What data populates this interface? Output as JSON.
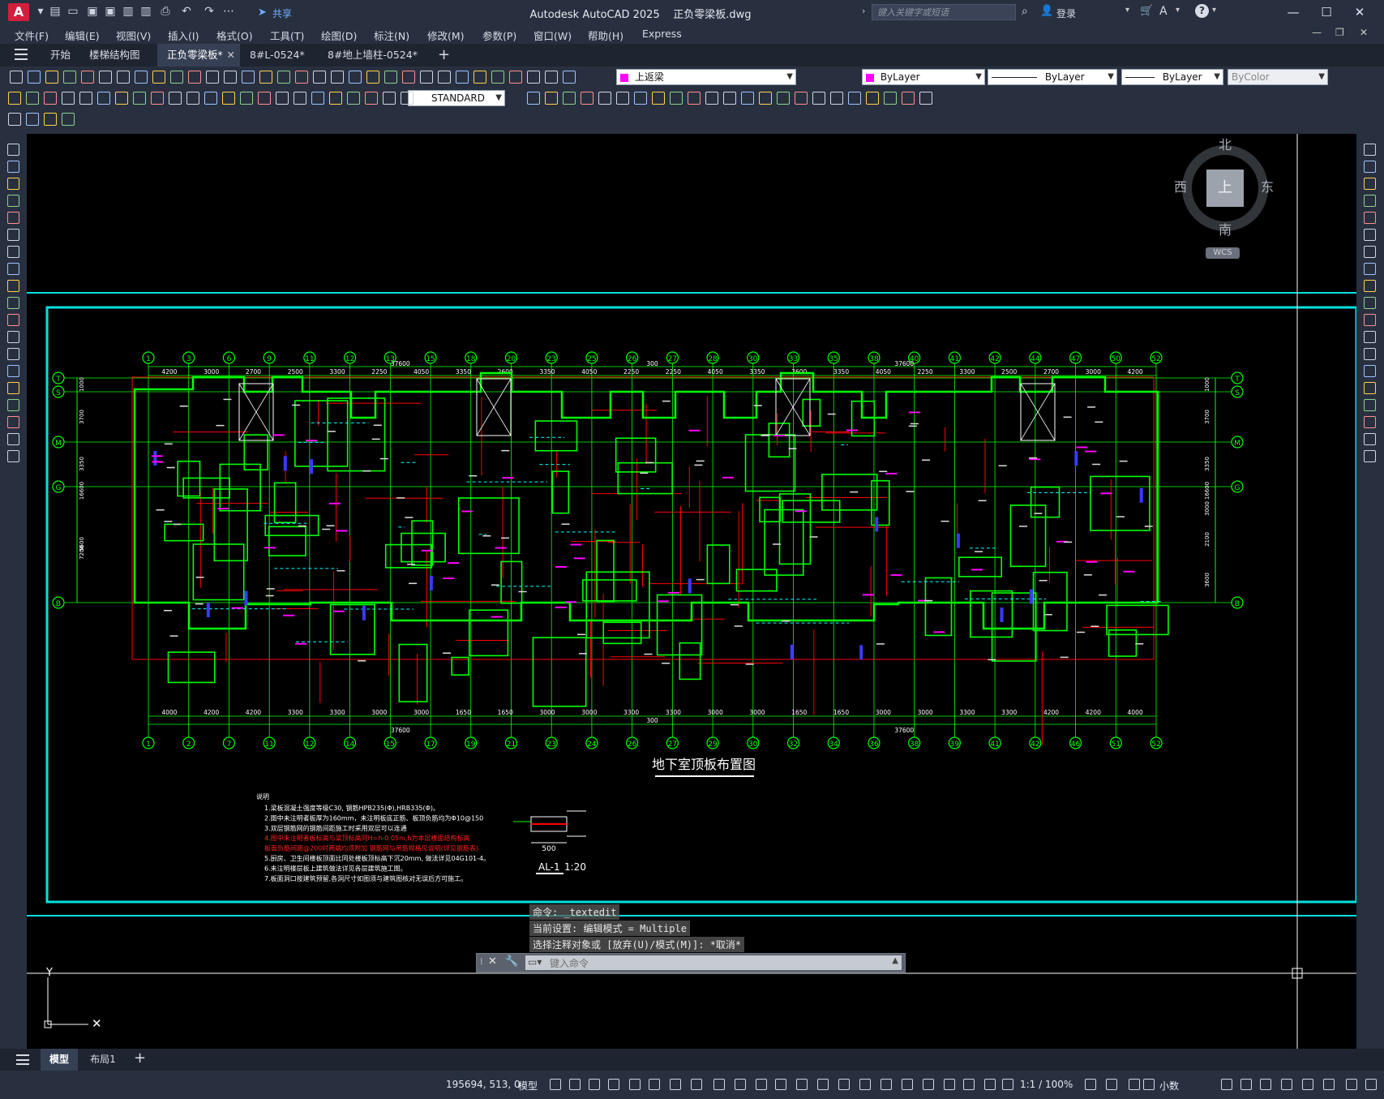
{
  "window": {
    "app_title": "Autodesk AutoCAD 2025",
    "file_title": "正负零梁板.dwg",
    "logo": "A",
    "share_label": "共享",
    "search_placeholder": "键入关键字或短语",
    "login_label": "登录"
  },
  "menu": [
    "文件(F)",
    "编辑(E)",
    "视图(V)",
    "插入(I)",
    "格式(O)",
    "工具(T)",
    "绘图(D)",
    "标注(N)",
    "修改(M)",
    "参数(P)",
    "窗口(W)",
    "帮助(H)",
    "Express"
  ],
  "file_tabs": [
    {
      "label": "开始",
      "active": false
    },
    {
      "label": "楼梯结构图",
      "active": false
    },
    {
      "label": "正负零梁板*",
      "active": true
    },
    {
      "label": "8#L-0524*",
      "active": false
    },
    {
      "label": "8#地上墙柱-0524*",
      "active": false
    }
  ],
  "properties": {
    "layer": "上返梁",
    "layer_color": "#ff00ff",
    "color": "ByLayer",
    "linetype": "ByLayer",
    "lineweight": "ByLayer",
    "plotstyle": "ByColor",
    "text_style": "STANDARD"
  },
  "viewcube": {
    "north": "北",
    "south": "南",
    "east": "东",
    "west": "西",
    "top": "上",
    "wcs": "WCS"
  },
  "drawing": {
    "top_axes": [
      "1",
      "3",
      "6",
      "9",
      "11",
      "12",
      "13",
      "15",
      "18",
      "20",
      "23",
      "25",
      "26",
      "27",
      "28",
      "30",
      "33",
      "35",
      "38",
      "40",
      "41",
      "42",
      "44",
      "47",
      "50",
      "52"
    ],
    "bottom_axes": [
      "1",
      "2",
      "7",
      "11",
      "12",
      "14",
      "15",
      "17",
      "19",
      "21",
      "23",
      "24",
      "26",
      "27",
      "29",
      "30",
      "32",
      "34",
      "36",
      "38",
      "39",
      "41",
      "42",
      "46",
      "51",
      "52"
    ],
    "left_axes": [
      "T",
      "S",
      "M",
      "G",
      "B"
    ],
    "top_dims": [
      "4200",
      "3000",
      "2700",
      "2500",
      "3300",
      "2250",
      "4050",
      "3350",
      "2600",
      "3350",
      "4050",
      "2250",
      "2250",
      "4050",
      "3350",
      "2600",
      "3350",
      "4050",
      "2250",
      "3300",
      "2500",
      "2700",
      "3000",
      "4200"
    ],
    "top_total_left": "37600",
    "top_total_right": "37600",
    "top_mid": "300",
    "bottom_dims": [
      "4000",
      "4200",
      "4200",
      "3300",
      "3300",
      "3000",
      "3000",
      "1650",
      "1650",
      "3000",
      "3000",
      "3300",
      "3300",
      "3000",
      "3000",
      "1650",
      "1650",
      "3000",
      "3000",
      "3300",
      "3300",
      "4200",
      "4200",
      "4000"
    ],
    "bottom_total_left": "37600",
    "bottom_total_right": "37600",
    "bottom_mid": "300",
    "left_dims": [
      "1000",
      "3700",
      "3350",
      "16600",
      "5600",
      "7200"
    ],
    "right_dims": [
      "1000",
      "3700",
      "3350",
      "16600",
      "3000",
      "2100",
      "3600"
    ],
    "drawing_title": "地下室顶板布置图",
    "notes_heading": "说明",
    "notes": [
      "1.梁板混凝土强度等级C30, 钢筋HPB235(Φ),HRB335(Φ)。",
      "2.图中未注明者板厚为160mm，未注明板底正筋、板顶负筋均为Φ10@150",
      "3.双层钢筋网的钢筋间距施工时采用双层可以连通",
      "4.图中未注明者板标高与梁顶标高同H=h-0.05m,h为本层楼面结构标高",
      "板面负筋间距@200时两端均须附加 钢筋网与吊筋规格见说明(详见钢筋表)",
      "5.厨房、卫生间楼板顶面比同处楼板顶标高下沉20mm, 做法详见04G101-4。",
      "6.未注明楼层板上建筑做法详见各层建筑施工图。",
      "7.板面洞口按建筑预留,各洞尺寸如图须与建筑图核对无误后方可施工。"
    ],
    "detail_label": "AL-1",
    "detail_scale": "1:20",
    "detail_dim": "500"
  },
  "command": {
    "lines": [
      "命令: _textedit",
      "当前设置: 编辑模式 = Multiple",
      "选择注释对象或 [放弃(U)/模式(M)]: *取消*"
    ],
    "input_placeholder": "键入命令"
  },
  "layout_tabs": [
    {
      "label": "模型",
      "active": true
    },
    {
      "label": "布局1",
      "active": false
    }
  ],
  "status": {
    "coords": "195694, 513, 0",
    "model_label": "模型",
    "scale": "1:1 / 100%",
    "units": "小数"
  },
  "colors": {
    "green": "#00ff00",
    "red": "#ff0000",
    "cyan": "#00ffff",
    "magenta": "#ff00ff",
    "white": "#ffffff",
    "blue": "#3a3aff"
  }
}
